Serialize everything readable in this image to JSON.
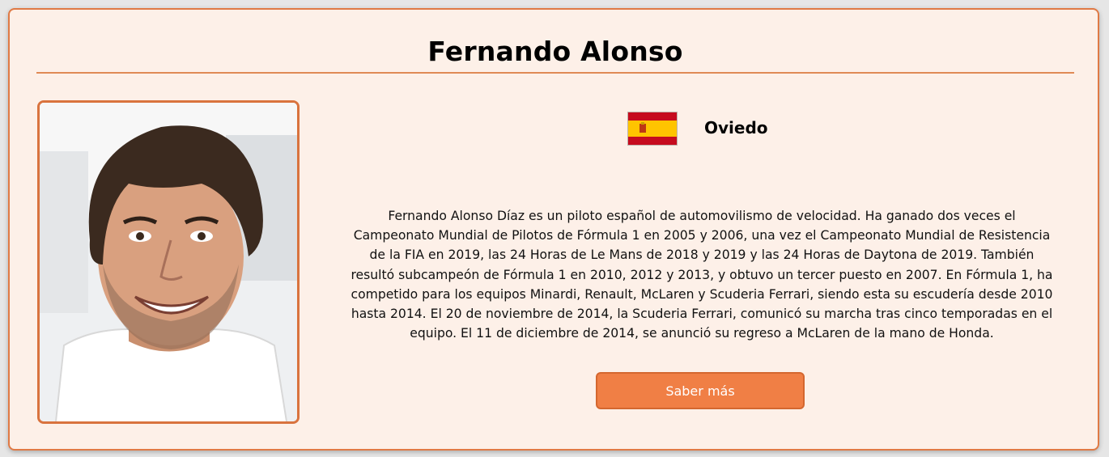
{
  "driver": {
    "name": "Fernando Alonso",
    "city": "Oviedo",
    "country_flag": "spain-flag",
    "bio": "Fernando Alonso Díaz es un piloto español de automovilismo de velocidad. Ha ganado dos veces el Campeonato Mundial de Pilotos de Fórmula 1 en 2005 y 2006, una vez el Campeonato Mundial de Resistencia de la FIA en 2019, las 24 Horas de Le Mans de 2018 y 2019 y las 24 Horas de Daytona de 2019. También resultó subcampeón de Fórmula 1 en 2010, 2012 y 2013, y obtuvo un tercer puesto en 2007. En Fórmula 1, ha competido para los equipos Minardi, Renault, McLaren y Scuderia Ferrari, siendo esta su escudería desde 2010 hasta 2014. El 20 de noviembre de 2014, la Scuderia Ferrari, comunicó su marcha tras cinco temporadas en el equipo. El 11 de diciembre de 2014, se anunció su regreso a McLaren de la mano de Honda.",
    "cta_label": "Saber más"
  },
  "colors": {
    "card_bg": "#fdf0e8",
    "accent": "#e07a45",
    "button_bg": "#f07f45"
  }
}
